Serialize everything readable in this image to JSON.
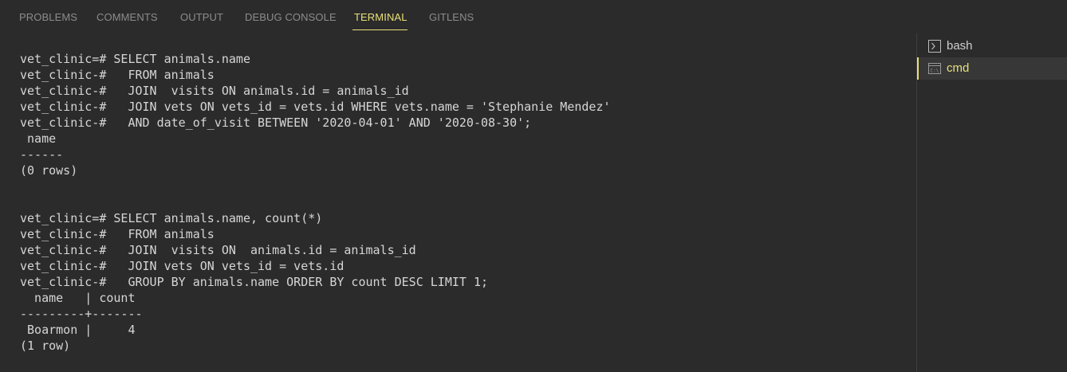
{
  "tabs": [
    {
      "label": "PROBLEMS"
    },
    {
      "label": "COMMENTS"
    },
    {
      "label": "OUTPUT"
    },
    {
      "label": "DEBUG CONSOLE"
    },
    {
      "label": "TERMINAL",
      "active": true
    },
    {
      "label": "GITLENS"
    }
  ],
  "terminal": {
    "lines": [
      "vet_clinic=# SELECT animals.name",
      "vet_clinic-#   FROM animals",
      "vet_clinic-#   JOIN  visits ON animals.id = animals_id",
      "vet_clinic-#   JOIN vets ON vets_id = vets.id WHERE vets.name = 'Stephanie Mendez'",
      "vet_clinic-#   AND date_of_visit BETWEEN '2020-04-01' AND '2020-08-30';",
      " name",
      "------",
      "(0 rows)",
      "",
      "",
      "vet_clinic=# SELECT animals.name, count(*)",
      "vet_clinic-#   FROM animals",
      "vet_clinic-#   JOIN  visits ON  animals.id = animals_id",
      "vet_clinic-#   JOIN vets ON vets_id = vets.id",
      "vet_clinic-#   GROUP BY animals.name ORDER BY count DESC LIMIT 1;",
      "  name   | count",
      "---------+-------",
      " Boarmon |     4",
      "(1 row)"
    ]
  },
  "terminal_list": {
    "items": [
      {
        "label": "bash",
        "icon": "terminal-icon"
      },
      {
        "label": "cmd",
        "icon": "cmd-icon",
        "selected": true
      }
    ]
  },
  "colors": {
    "background": "#2b2b2b",
    "accent": "#e8e07a",
    "text": "#d6d6d6",
    "tab_inactive": "#8c8c8c"
  }
}
